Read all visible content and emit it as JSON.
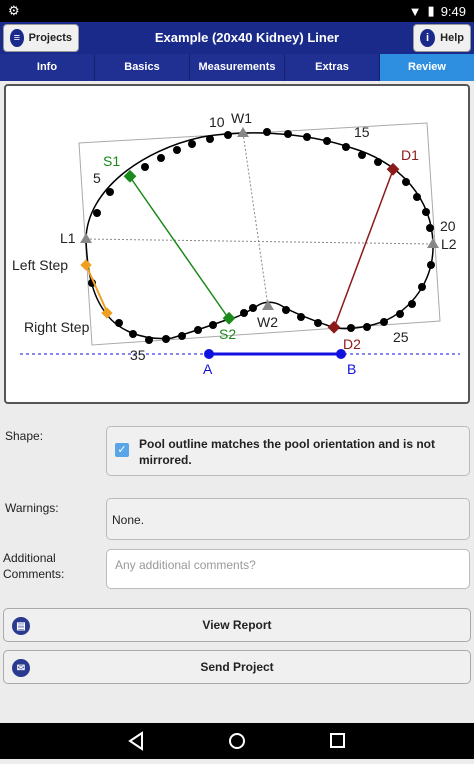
{
  "status": {
    "time": "9:49"
  },
  "header": {
    "projects_label": "Projects",
    "title": "Example (20x40 Kidney) Liner",
    "help_label": "Help"
  },
  "tabs": [
    {
      "label": "Info"
    },
    {
      "label": "Basics"
    },
    {
      "label": "Measurements"
    },
    {
      "label": "Extras"
    },
    {
      "label": "Review",
      "active": true
    }
  ],
  "diagram": {
    "labels": {
      "W1": "W1",
      "W2": "W2",
      "S1": "S1",
      "S2": "S2",
      "D1": "D1",
      "D2": "D2",
      "L1": "L1",
      "L2": "L2",
      "A": "A",
      "B": "B",
      "n5": "5",
      "n10": "10",
      "n15": "15",
      "n20": "20",
      "n25": "25",
      "n35": "35",
      "left_step": "Left Step",
      "right_step": "Right Step"
    }
  },
  "form": {
    "shape_label": "Shape:",
    "shape_text": "Pool outline matches the pool orientation and is not mirrored.",
    "shape_checked": true,
    "warnings_label": "Warnings:",
    "warnings_value": "None.",
    "comments_label": "Additional Comments:",
    "comments_placeholder": "Any additional comments?"
  },
  "actions": {
    "view_report": "View Report",
    "send_project": "Send Project"
  },
  "icons": {
    "back": "back-icon",
    "home": "home-icon",
    "recents": "recents-icon",
    "help": "info-icon",
    "projects": "list-icon"
  },
  "colors": {
    "header": "#1a2a8a",
    "tab_active": "#2e8fe0",
    "green": "#1a8a1a",
    "darkred": "#8b1a1a",
    "blue": "#1010e0",
    "orange": "#f0a020"
  }
}
